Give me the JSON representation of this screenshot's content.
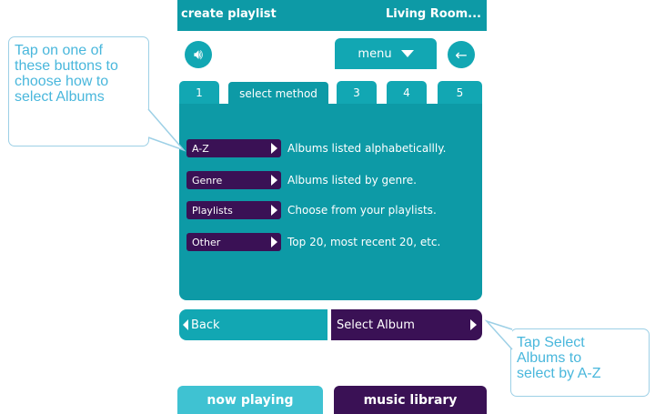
{
  "titlebar": {
    "title": "create playlist",
    "zone": "Living Room..."
  },
  "toolbar": {
    "menu_label": "menu",
    "volume_icon": "speaker-icon",
    "back_icon": "back-arrow-icon"
  },
  "tabs": [
    {
      "label": "1"
    },
    {
      "label": "select method"
    },
    {
      "label": "3"
    },
    {
      "label": "4"
    },
    {
      "label": "5"
    }
  ],
  "methods": [
    {
      "button": "A-Z",
      "description": "Albums listed alphabeticallly."
    },
    {
      "button": "Genre",
      "description": "Albums listed by genre."
    },
    {
      "button": "Playlists",
      "description": "Choose from your playlists."
    },
    {
      "button": "Other",
      "description": "Top 20, most recent 20, etc."
    }
  ],
  "nav": {
    "back_label": "Back",
    "next_label": "Select Album"
  },
  "bottom_tabs": {
    "now_playing": "now playing",
    "music_library": "music library"
  },
  "callouts": {
    "left": "Tap on one of these buttons to choose how to select Albums",
    "right": "Tap Select Albums to select by A-Z"
  },
  "colors": {
    "teal": "#0d9aa6",
    "light_teal": "#12a7b3",
    "purple": "#3a1155",
    "callout_text": "#49b7dc"
  }
}
